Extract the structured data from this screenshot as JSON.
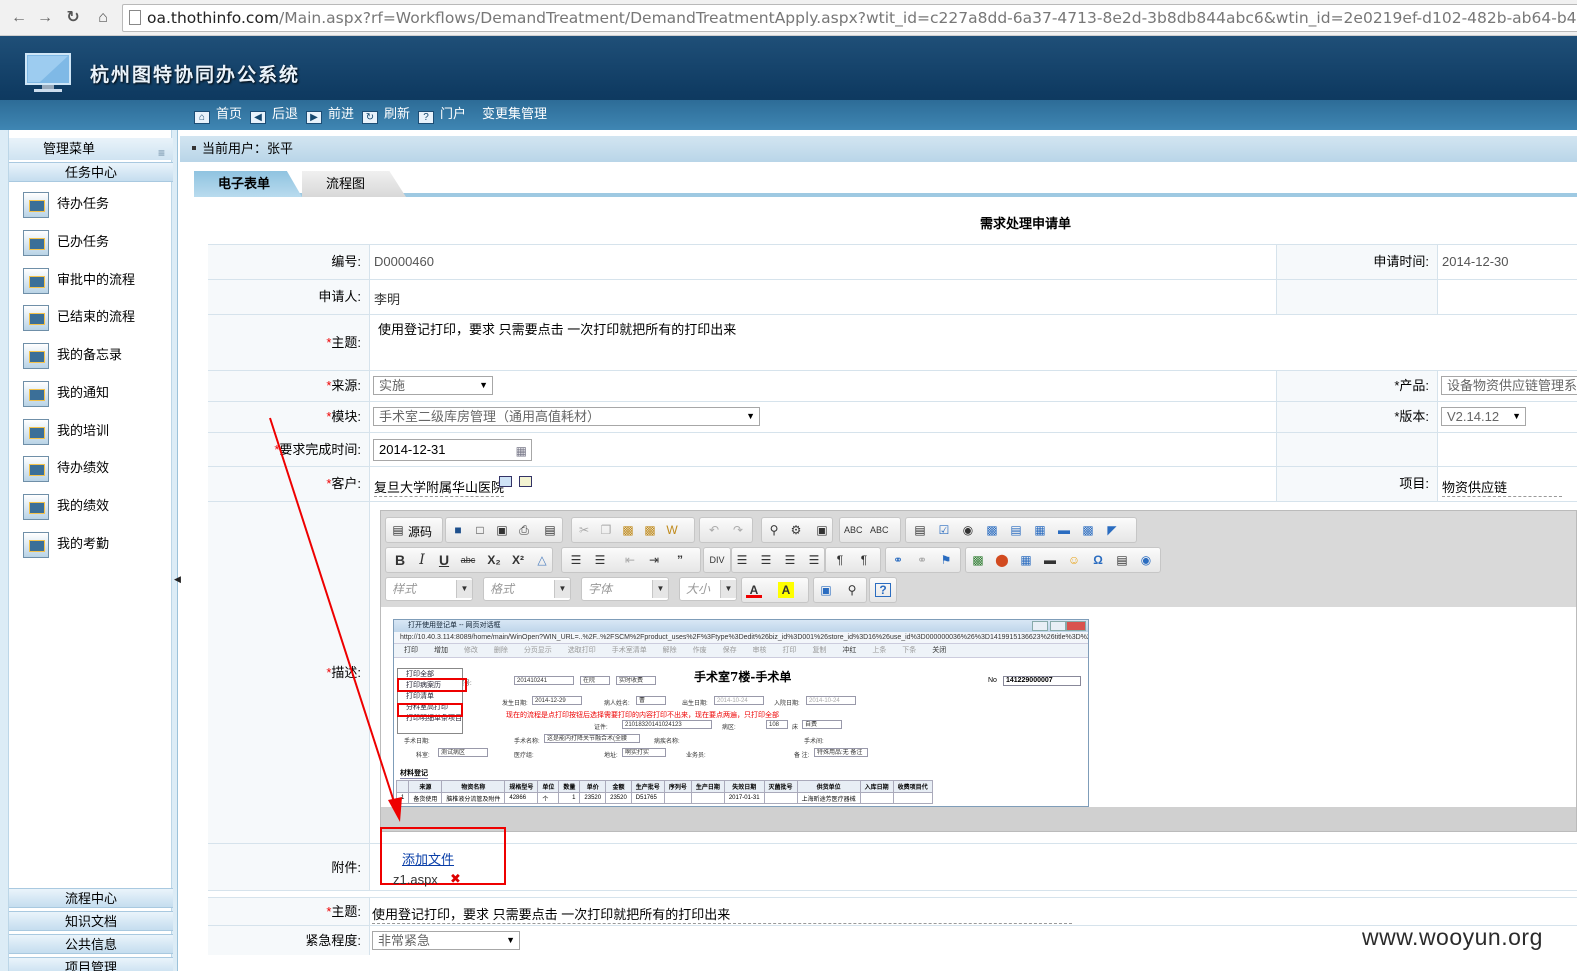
{
  "browser": {
    "url_host": "oa.thothinfo.com",
    "url_path": "/Main.aspx?rf=Workflows/DemandTreatment/DemandTreatmentApply.aspx?wtit_id=c227a8dd-6a37-4713-8e2d-3b8db844abc6&wtin_id=2e0219ef-d102-482b-ab64-b4"
  },
  "header": {
    "app_title": "杭州图特协同办公系统",
    "nav": [
      {
        "label": "首页"
      },
      {
        "label": "后退"
      },
      {
        "label": "前进"
      },
      {
        "label": "刷新"
      },
      {
        "label": "门户"
      },
      {
        "label": "变更集管理"
      }
    ]
  },
  "sidebar": {
    "menu_title": "管理菜单",
    "task_center": "任务中心",
    "items": [
      {
        "label": "待办任务"
      },
      {
        "label": "已办任务"
      },
      {
        "label": "审批中的流程"
      },
      {
        "label": "已结束的流程"
      },
      {
        "label": "我的备忘录"
      },
      {
        "label": "我的通知"
      },
      {
        "label": "我的培训"
      },
      {
        "label": "待办绩效"
      },
      {
        "label": "我的绩效"
      },
      {
        "label": "我的考勤"
      }
    ],
    "bottom_sections": [
      {
        "label": "流程中心"
      },
      {
        "label": "知识文档"
      },
      {
        "label": "公共信息"
      },
      {
        "label": "项目管理"
      }
    ]
  },
  "userbar": {
    "text": "当前用户：张平"
  },
  "tabs": [
    {
      "label": "电子表单"
    },
    {
      "label": "流程图"
    }
  ],
  "form": {
    "title": "需求处理申请单",
    "number_label": "编号:",
    "number_value": "D0000460",
    "apply_time_label": "申请时间:",
    "apply_time_value": "2014-12-30",
    "applicant_label": "申请人:",
    "applicant_value": "李明",
    "subject_label": "主题:",
    "subject_value": "使用登记打印，要求 只需要点击 一次打印就把所有的打印出来",
    "source_label": "来源:",
    "source_value": "实施",
    "product_label": "产品:",
    "product_value": "设备物资供应链管理系",
    "module_label": "模块:",
    "module_value": "手术室二级库房管理（通用高值耗材）",
    "version_label": "版本:",
    "version_value": "V2.14.12",
    "due_label": "要求完成时间:",
    "due_value": "2014-12-31",
    "customer_label": "客户:",
    "customer_value": "复旦大学附属华山医院",
    "project_label": "项目:",
    "project_value": "物资供应链",
    "desc_label": "描述:",
    "attach_label": "附件:",
    "add_file": "添加文件",
    "file_name": "z1.aspx",
    "subject2_label": "主题:",
    "subject2_value": "使用登记打印，要求 只需要点击 一次打印就把所有的打印出来",
    "urgency_label": "紧急程度:",
    "urgency_value": "非常紧急"
  },
  "editor": {
    "source_label": "源码",
    "style_combo": "样式",
    "format_combo": "格式",
    "font_combo": "字体",
    "size_combo": "大小"
  },
  "embed": {
    "window_title": "打开使用登记单 -- 网页对话框",
    "url": "http://10.40.3.114:8089/home/main/WinOpen?WIN_URL=..%2F..%2FSCM%2Fproduct_uses%2F%3Ftype%3Dedit%26biz_id%3D001%26store_id%3D16%26use_id%3D000000036%26%3D1419915136623%26title%3D%25u6253%2",
    "toolbar": [
      "打印",
      "增加",
      "修改",
      "删除",
      "分页显示",
      "选取打印",
      "手术室清单",
      "解除",
      "作废",
      "保存",
      "审核",
      "打印",
      "复制",
      "冲红",
      "上条",
      "下条",
      "关闭"
    ],
    "heading": "手术室7楼-手术单",
    "no_label": "No",
    "no_value": "141229000007",
    "popup": [
      "打印全部",
      "打印病案历",
      "打印清单",
      "分科室高打印",
      "打印明细单条项目"
    ],
    "note": "现在的流程是点打印按钮后选择需要打印的内容打印不出来，现在要点两遍，只打印全部",
    "fields": {
      "case_no_label": "病案号:",
      "case_no": "201410241",
      "status": "在院",
      "charge": "实时收费",
      "occur_date_label": "发生日期:",
      "occur_date": "2014-12-29",
      "patient_label": "病人姓名:",
      "patient_value": "曹",
      "birth_label": "出生日期:",
      "birth_value": "2014-10-24",
      "admit_label": "入院日期:",
      "admit_value": "2014-10-24",
      "id_label": "证件:",
      "id_value": "21018320141024123",
      "ward_label": "病区:",
      "ward_value": "108",
      "bed_label": "床",
      "bed_value": "自费",
      "op_date_label": "手术日期:",
      "op_name_label": "手术名称:",
      "op_name_value": "这是能内打降关节融合术(全腰",
      "disease_label": "病疾名称:",
      "operator_label": "手术间:",
      "dept_label": "科室:",
      "dept_value": "测试病区",
      "doctor_label": "医疗组:",
      "address_label": "地址:",
      "address_value": "啊实打实",
      "nurse_label": "业务员:",
      "remark_label": "备 注:",
      "remark_value": "特殊用品:无 备注"
    },
    "material_tab": "材料登记",
    "columns": [
      "来源",
      "物资名称",
      "规格型号",
      "单位",
      "数量",
      "单价",
      "金额",
      "生产批号",
      "序列号",
      "生产日期",
      "失效日期",
      "灭菌批号",
      "供货单位",
      "入库日期",
      "收费项目代"
    ],
    "row": [
      "备货使用",
      "脑椎液分流管及附件",
      "42866",
      "个",
      "1",
      "23520",
      "23520",
      "D51765",
      "",
      "",
      "2017-01-31",
      "",
      "上海昕途芳医疗器械",
      "",
      ""
    ],
    "row_index": "1"
  },
  "watermark": "www.wooyun.org"
}
